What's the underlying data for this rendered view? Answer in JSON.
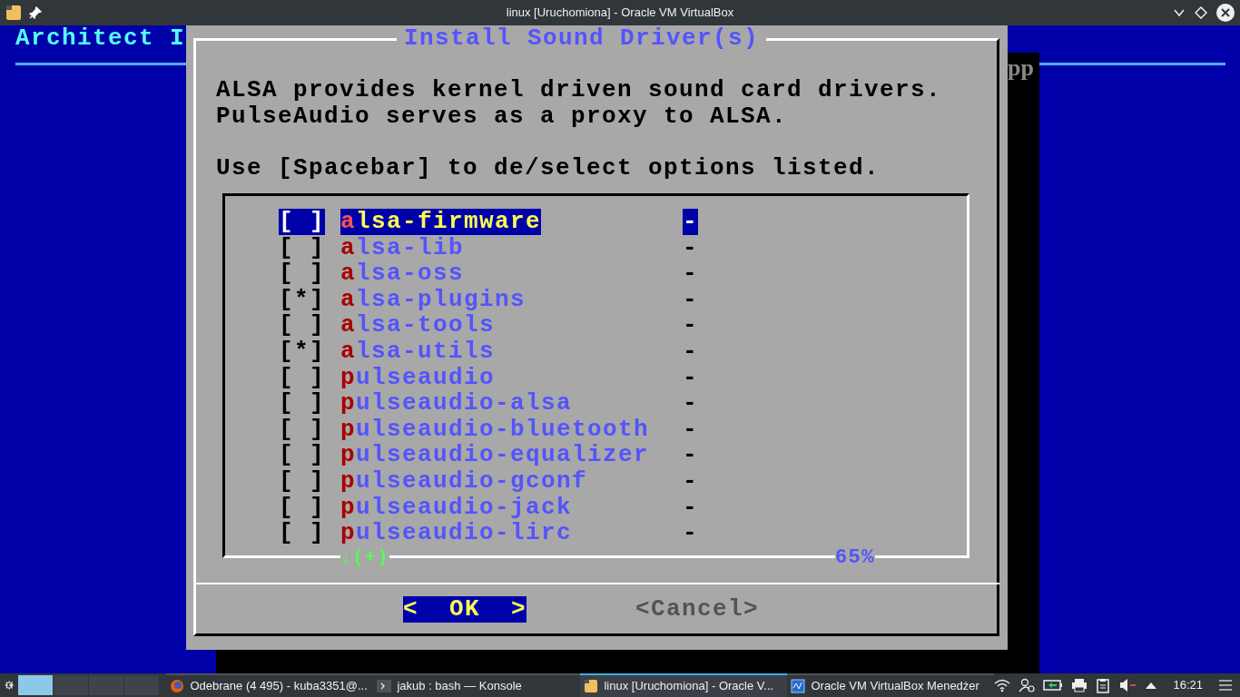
{
  "window": {
    "title": "linux [Uruchomiona] - Oracle VM VirtualBox"
  },
  "installer": {
    "header": "Architect I",
    "stray_text": "pp"
  },
  "dialog": {
    "title": "Install Sound Driver(s)",
    "intro": "ALSA provides kernel driven sound card drivers.\nPulseAudio serves as a proxy to ALSA.",
    "instruction": "Use [Spacebar] to de/select options listed.",
    "items": [
      {
        "box": "[ ]",
        "name": "alsa-firmware",
        "status": "-",
        "selected": true
      },
      {
        "box": "[ ]",
        "name": "alsa-lib",
        "status": "-",
        "selected": false
      },
      {
        "box": "[ ]",
        "name": "alsa-oss",
        "status": "-",
        "selected": false
      },
      {
        "box": "[*]",
        "name": "alsa-plugins",
        "status": "-",
        "selected": false
      },
      {
        "box": "[ ]",
        "name": "alsa-tools",
        "status": "-",
        "selected": false
      },
      {
        "box": "[*]",
        "name": "alsa-utils",
        "status": "-",
        "selected": false
      },
      {
        "box": "[ ]",
        "name": "pulseaudio",
        "status": "-",
        "selected": false
      },
      {
        "box": "[ ]",
        "name": "pulseaudio-alsa",
        "status": "-",
        "selected": false
      },
      {
        "box": "[ ]",
        "name": "pulseaudio-bluetooth",
        "status": "-",
        "selected": false
      },
      {
        "box": "[ ]",
        "name": "pulseaudio-equalizer",
        "status": "-",
        "selected": false
      },
      {
        "box": "[ ]",
        "name": "pulseaudio-gconf",
        "status": "-",
        "selected": false
      },
      {
        "box": "[ ]",
        "name": "pulseaudio-jack",
        "status": "-",
        "selected": false
      },
      {
        "box": "[ ]",
        "name": "pulseaudio-lirc",
        "status": "-",
        "selected": false
      }
    ],
    "scroll_hint": "↓(+)",
    "scroll_percent": "65%",
    "buttons": [
      {
        "label": "<  OK  >",
        "selected": true
      },
      {
        "label": "<Cancel>",
        "selected": false
      }
    ]
  },
  "taskbar": {
    "desktops": [
      {
        "selected": true
      },
      {
        "selected": false
      },
      {
        "selected": false
      },
      {
        "selected": false
      }
    ],
    "tasks": [
      {
        "kind": "browser",
        "label": "Odebrane (4 495) - kuba3351@...",
        "selected": false
      },
      {
        "kind": "terminal",
        "label": "jakub : bash — Konsole",
        "selected": false
      },
      {
        "kind": "vm",
        "label": "linux [Uruchomiona] - Oracle V...",
        "selected": true
      },
      {
        "kind": "manager",
        "label": "Oracle VM VirtualBox Menedżer",
        "selected": false
      }
    ],
    "clock": "16:21"
  }
}
